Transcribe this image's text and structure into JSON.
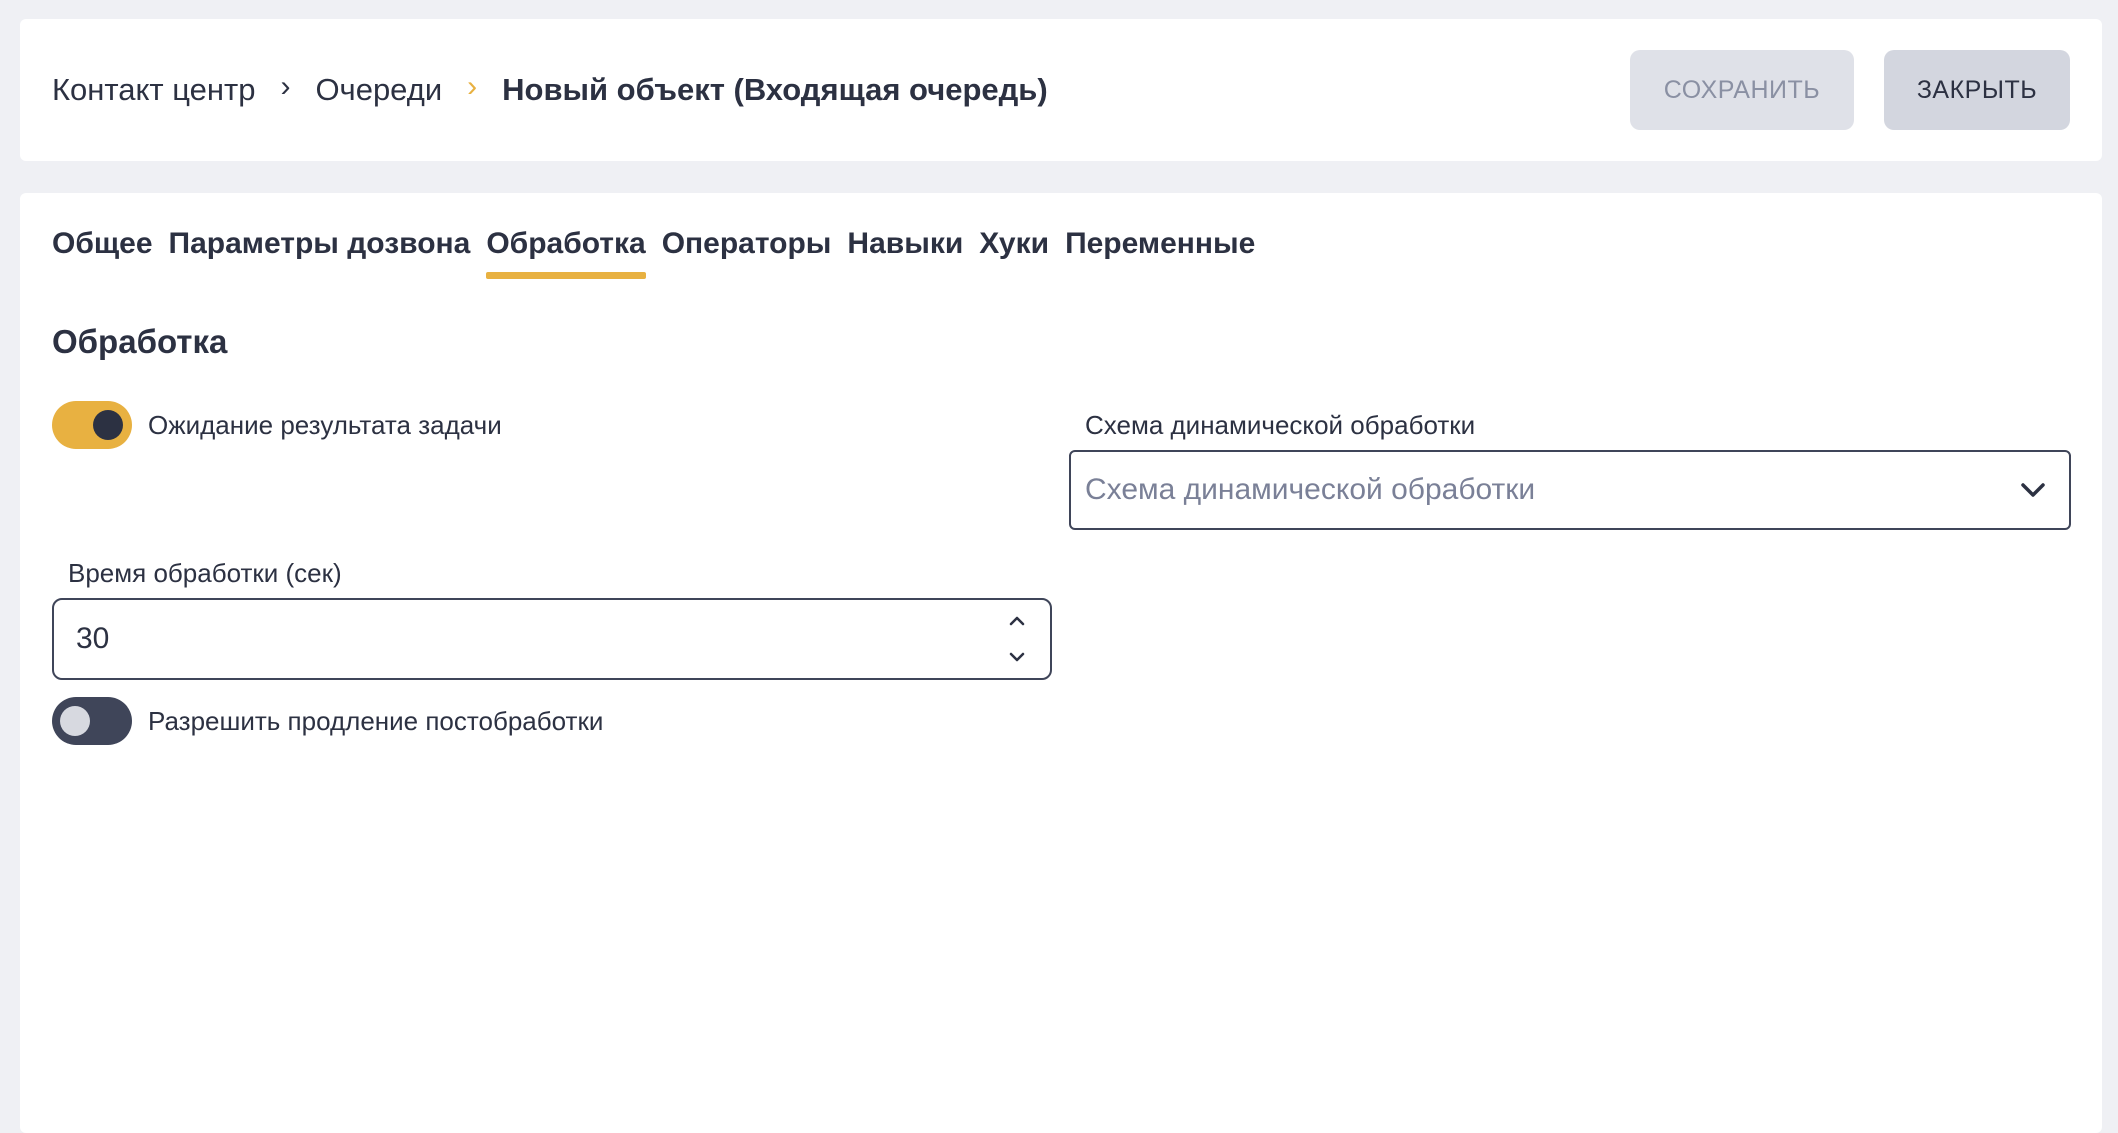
{
  "breadcrumb": {
    "items": [
      "Контакт центр",
      "Очереди"
    ],
    "current": "Новый объект (Входящая очередь)"
  },
  "actions": {
    "save_label": "СОХРАНИТЬ",
    "close_label": "ЗАКРЫТЬ"
  },
  "tabs": [
    {
      "label": "Общее",
      "active": false
    },
    {
      "label": "Параметры дозвона",
      "active": false
    },
    {
      "label": "Обработка",
      "active": true
    },
    {
      "label": "Операторы",
      "active": false
    },
    {
      "label": "Навыки",
      "active": false
    },
    {
      "label": "Хуки",
      "active": false
    },
    {
      "label": "Переменные",
      "active": false
    }
  ],
  "section": {
    "title": "Обработка"
  },
  "form": {
    "wait_result": {
      "label": "Ожидание результата задачи",
      "enabled": true
    },
    "dynamic_schema": {
      "label": "Схема динамической обработки",
      "placeholder": "Схема динамической обработки"
    },
    "processing_time": {
      "label": "Время обработки (сек)",
      "value": "30"
    },
    "allow_extension": {
      "label": "Разрешить продление постобработки",
      "enabled": false
    }
  },
  "colors": {
    "accent": "#e8b141",
    "background": "#eff0f4",
    "text": "#2c3142"
  }
}
